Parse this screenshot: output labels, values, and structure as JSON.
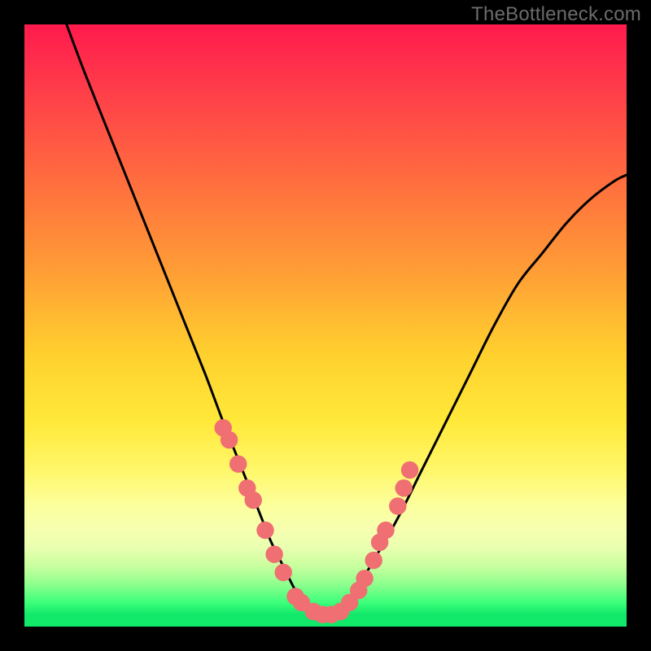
{
  "watermark": "TheBottleneck.com",
  "chart_data": {
    "type": "line",
    "title": "",
    "xlabel": "",
    "ylabel": "",
    "xlim": [
      0,
      100
    ],
    "ylim": [
      0,
      100
    ],
    "curve": {
      "name": "bottleneck-curve",
      "x": [
        7,
        10,
        14,
        18,
        22,
        26,
        30,
        33,
        35,
        37,
        39,
        41,
        43,
        45,
        47,
        49,
        51,
        53,
        55,
        58,
        62,
        66,
        70,
        74,
        78,
        82,
        86,
        90,
        94,
        98,
        100
      ],
      "y": [
        100,
        92,
        82,
        72,
        62,
        52,
        42,
        34,
        29,
        24,
        19,
        14,
        10,
        6,
        3,
        2,
        2,
        3,
        6,
        11,
        18,
        26,
        34,
        42,
        50,
        57,
        62,
        67,
        71,
        74,
        75
      ]
    },
    "scatter_points": {
      "name": "highlighted-points",
      "color": "#ef6f72",
      "x": [
        33,
        34,
        35.5,
        37,
        38,
        40,
        41.5,
        43,
        45,
        46,
        48,
        49.5,
        51,
        52.5,
        54,
        55.5,
        56.5,
        58,
        59,
        60,
        62,
        63,
        64
      ],
      "y": [
        33,
        31,
        27,
        23,
        21,
        16,
        12,
        9,
        5,
        4,
        2.5,
        2,
        2,
        2.5,
        4,
        6,
        8,
        11,
        14,
        16,
        20,
        23,
        26
      ]
    },
    "background_gradient_stops": [
      {
        "pos": 0,
        "color": "#ff1a4d"
      },
      {
        "pos": 25,
        "color": "#ff6a3f"
      },
      {
        "pos": 55,
        "color": "#ffd12e"
      },
      {
        "pos": 80,
        "color": "#fcff9e"
      },
      {
        "pos": 93,
        "color": "#8dff8d"
      },
      {
        "pos": 100,
        "color": "#12e86a"
      }
    ]
  }
}
